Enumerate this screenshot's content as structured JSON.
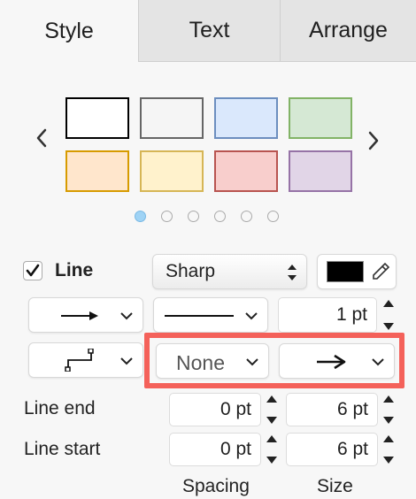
{
  "tabs": [
    {
      "label": "Style",
      "active": true
    },
    {
      "label": "Text",
      "active": false
    },
    {
      "label": "Arrange",
      "active": false
    }
  ],
  "swatches": [
    {
      "fill": "#ffffff",
      "stroke": "#000000"
    },
    {
      "fill": "#f5f5f5",
      "stroke": "#666666"
    },
    {
      "fill": "#dae8fc",
      "stroke": "#6c8ebf"
    },
    {
      "fill": "#d5e8d4",
      "stroke": "#82b366"
    },
    {
      "fill": "#ffe6cc",
      "stroke": "#d79b00"
    },
    {
      "fill": "#fff2cc",
      "stroke": "#d6b656"
    },
    {
      "fill": "#f8cecc",
      "stroke": "#b85450"
    },
    {
      "fill": "#e1d5e7",
      "stroke": "#9673a6"
    }
  ],
  "palette_pages": {
    "count": 6,
    "active_index": 0
  },
  "line": {
    "checked": true,
    "label": "Line",
    "style_select": "Sharp",
    "color": "#000000",
    "width_value": "1 pt",
    "start_marker": "None",
    "end_marker_icon": "arrow-right-icon",
    "pattern_icon": "solid-line-icon",
    "connector_icon": "orthogonal-connector-icon",
    "waypoint_icon": "arrow-right-icon"
  },
  "line_end": {
    "label": "Line end",
    "spacing": "0 pt",
    "size": "6 pt"
  },
  "line_start": {
    "label": "Line start",
    "spacing": "0 pt",
    "size": "6 pt"
  },
  "column_labels": {
    "spacing": "Spacing",
    "size": "Size"
  },
  "highlight_color": "#f4615a"
}
